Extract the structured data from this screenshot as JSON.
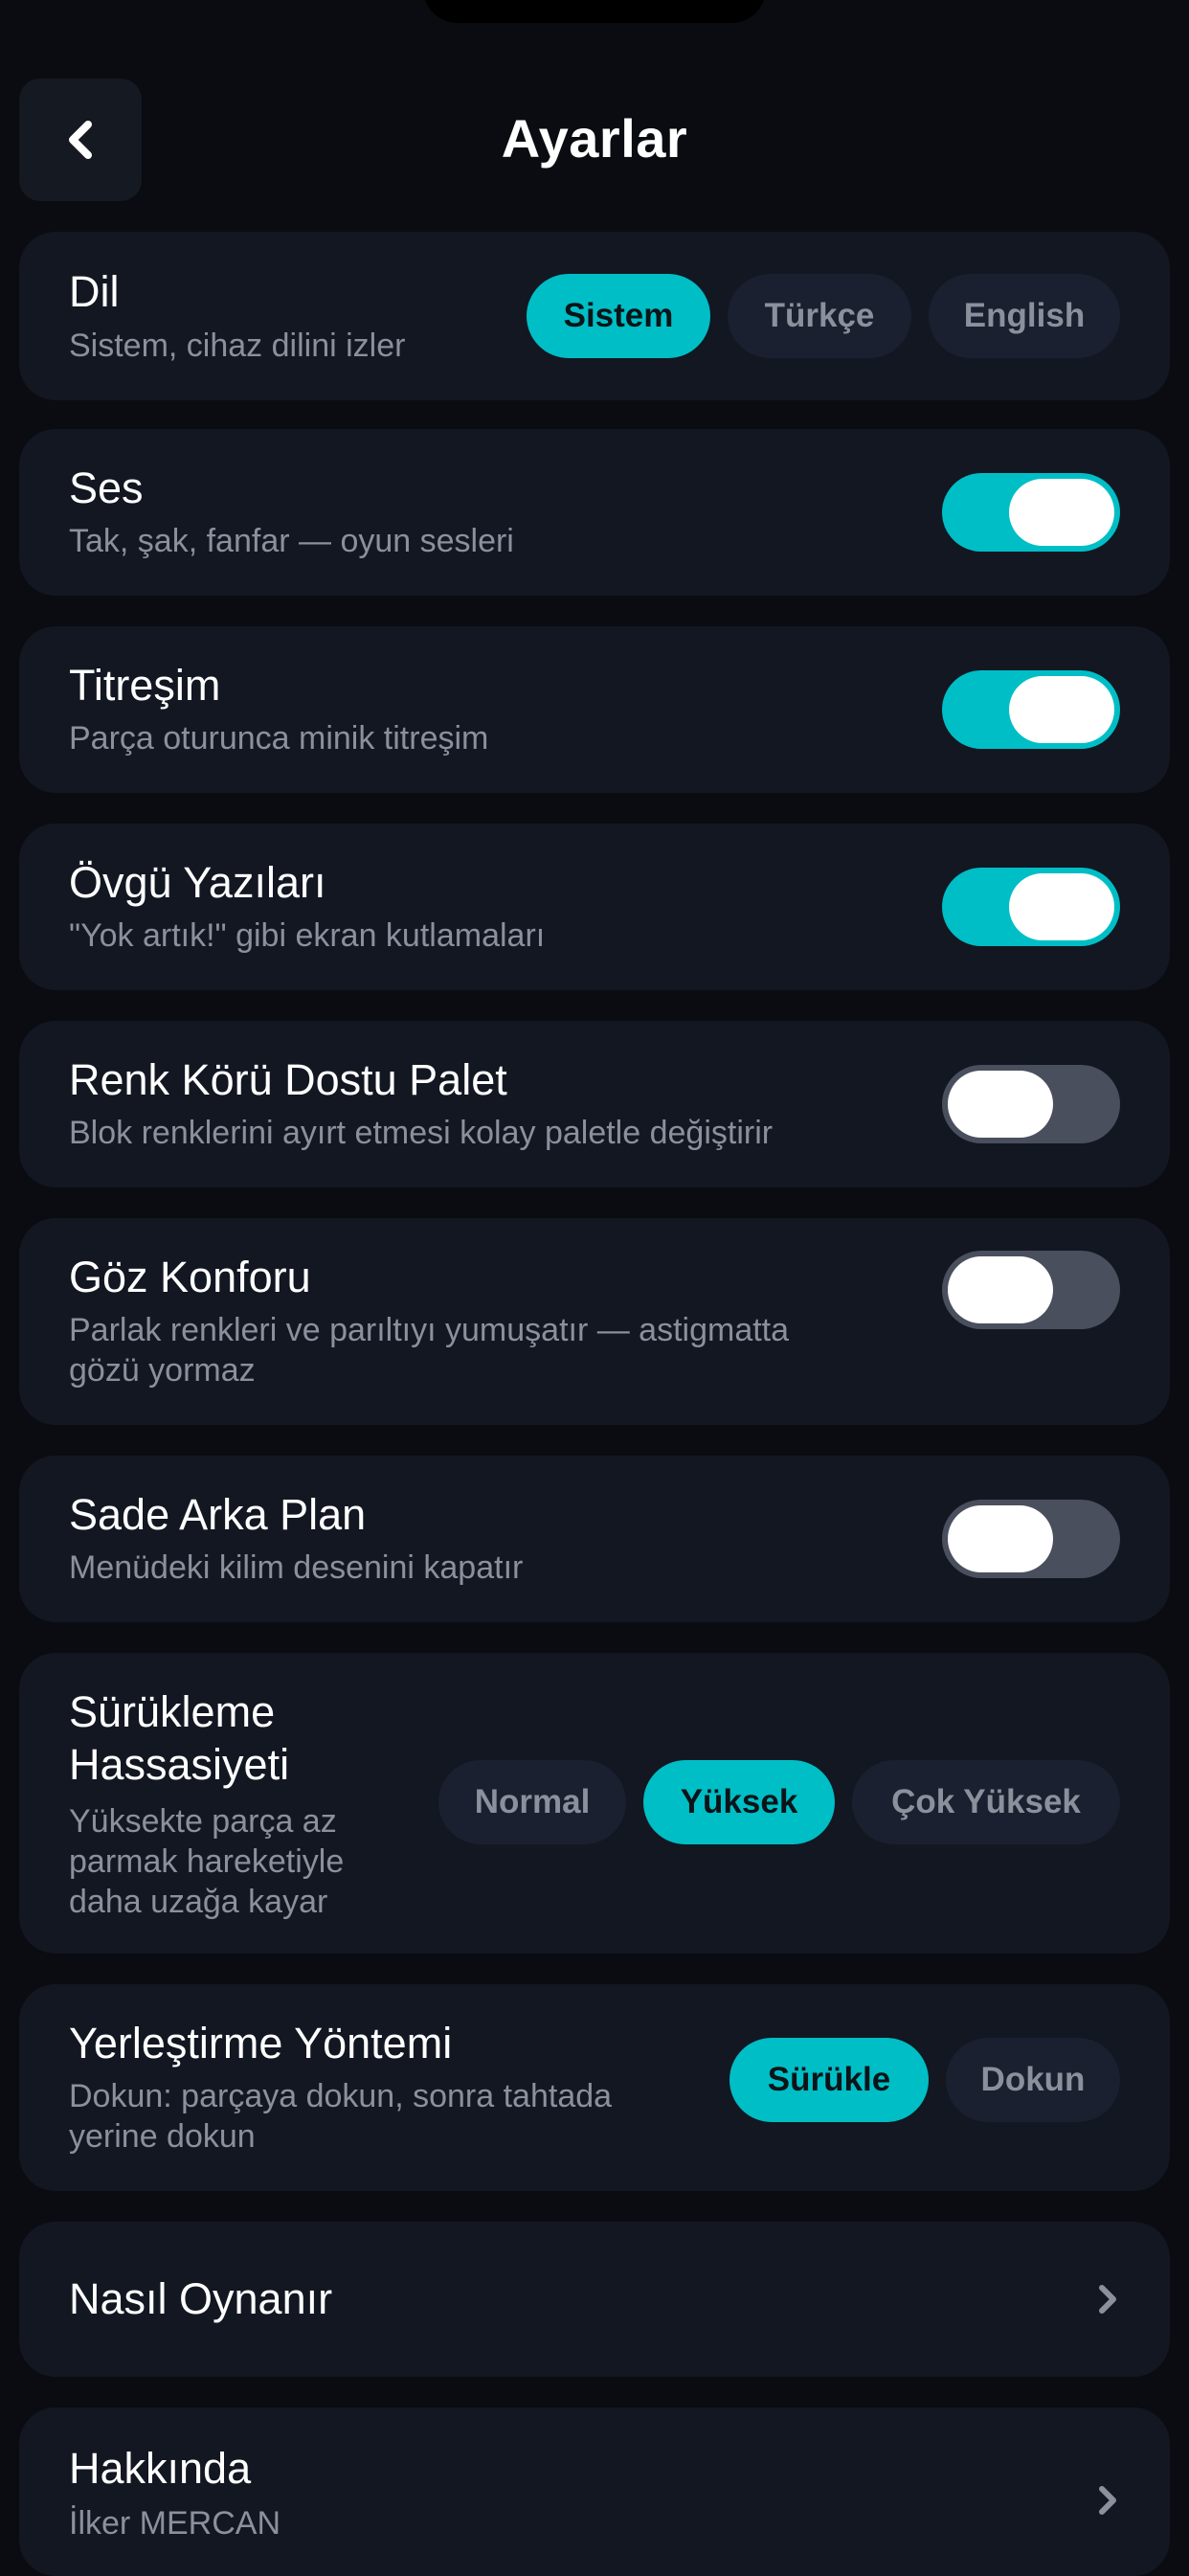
{
  "header": {
    "title": "Ayarlar",
    "back_icon": "chevron-left-icon"
  },
  "colors": {
    "accent": "#00bec5",
    "card": "#121722",
    "background": "#0a0c11",
    "toggle_off": "#4a4f5e"
  },
  "language": {
    "title": "Dil",
    "subtitle": "Sistem, cihaz dilini izler",
    "options": [
      "Sistem",
      "Türkçe",
      "English"
    ],
    "selected": "Sistem"
  },
  "sound": {
    "title": "Ses",
    "subtitle": "Tak, şak, fanfar — oyun sesleri",
    "on": true
  },
  "vibration": {
    "title": "Titreşim",
    "subtitle": "Parça oturunca minik titreşim",
    "on": true
  },
  "praise": {
    "title": "Övgü Yazıları",
    "subtitle": "\"Yok artık!\" gibi ekran kutlamaları",
    "on": true
  },
  "colorblind": {
    "title": "Renk Körü Dostu Palet",
    "subtitle": "Blok renklerini ayırt etmesi kolay paletle değiştirir",
    "on": false
  },
  "eye_comfort": {
    "title": "Göz Konforu",
    "subtitle_1": "Parlak renkleri ve parıltıyı yumuşatır — astigmatta",
    "subtitle_2": "gözü yormaz",
    "on": false
  },
  "plain_bg": {
    "title": "Sade Arka Plan",
    "subtitle": "Menüdeki kilim desenini kapatır",
    "on": false
  },
  "drag_sensitivity": {
    "title_1": "Sürükleme",
    "title_2": "Hassasiyeti",
    "subtitle_1": "Yüksekte parça az",
    "subtitle_2": "parmak hareketiyle",
    "subtitle_3": "daha uzağa kayar",
    "options": [
      "Normal",
      "Yüksek",
      "Çok Yüksek"
    ],
    "selected": "Yüksek"
  },
  "placement": {
    "title": "Yerleştirme Yöntemi",
    "subtitle_1": "Dokun: parçaya dokun, sonra tahtada",
    "subtitle_2": "yerine dokun",
    "options": [
      "Sürükle",
      "Dokun"
    ],
    "selected": "Sürükle"
  },
  "how_to_play": {
    "title": "Nasıl Oynanır",
    "icon": "chevron-right-icon"
  },
  "about": {
    "title": "Hakkında",
    "subtitle": "İlker MERCAN",
    "icon": "chevron-right-icon"
  }
}
